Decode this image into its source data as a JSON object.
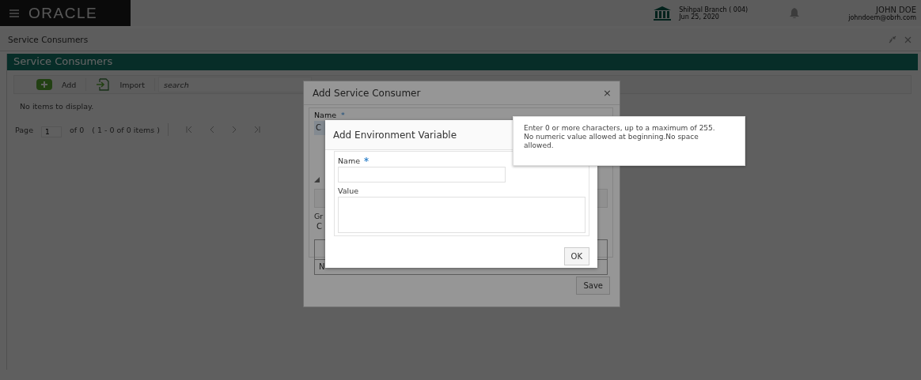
{
  "header": {
    "logo": "ORACLE",
    "branch": {
      "name": "Shihpal Branch ( 004)",
      "date": "Jun 25, 2020"
    },
    "user": {
      "name": "JOHN DOE",
      "email": "johndoem@obrh.com"
    }
  },
  "page": {
    "title": "Service Consumers",
    "banner": "Service Consumers",
    "toolbar": [
      {
        "kind": "add",
        "label": "Add"
      },
      {
        "kind": "import",
        "label": "Import"
      }
    ],
    "search": {
      "placeholder": "search"
    },
    "empty_message": "No items to display.",
    "pager": {
      "label": "Page",
      "value": "1",
      "of": "of 0",
      "range": "( 1 - 0 of 0 items )"
    }
  },
  "outer_dialog": {
    "title": "Add Service Consumer",
    "close": "×",
    "name_label": "Name",
    "required_mark": "*",
    "name_value": "C",
    "group_label": "Gr",
    "group_value": "C",
    "table_cell": "N",
    "save": "Save"
  },
  "inner_dialog": {
    "title": "Add Environment Variable",
    "fields": [
      {
        "kind": "input",
        "label": "Name",
        "required": true
      },
      {
        "kind": "textarea",
        "label": "Value",
        "required": false
      }
    ],
    "ok": "OK"
  },
  "tooltip": {
    "lines": [
      "Enter 0 or more characters, up to a maximum of 255.",
      "No numeric value allowed at beginning.No space allowed."
    ]
  }
}
